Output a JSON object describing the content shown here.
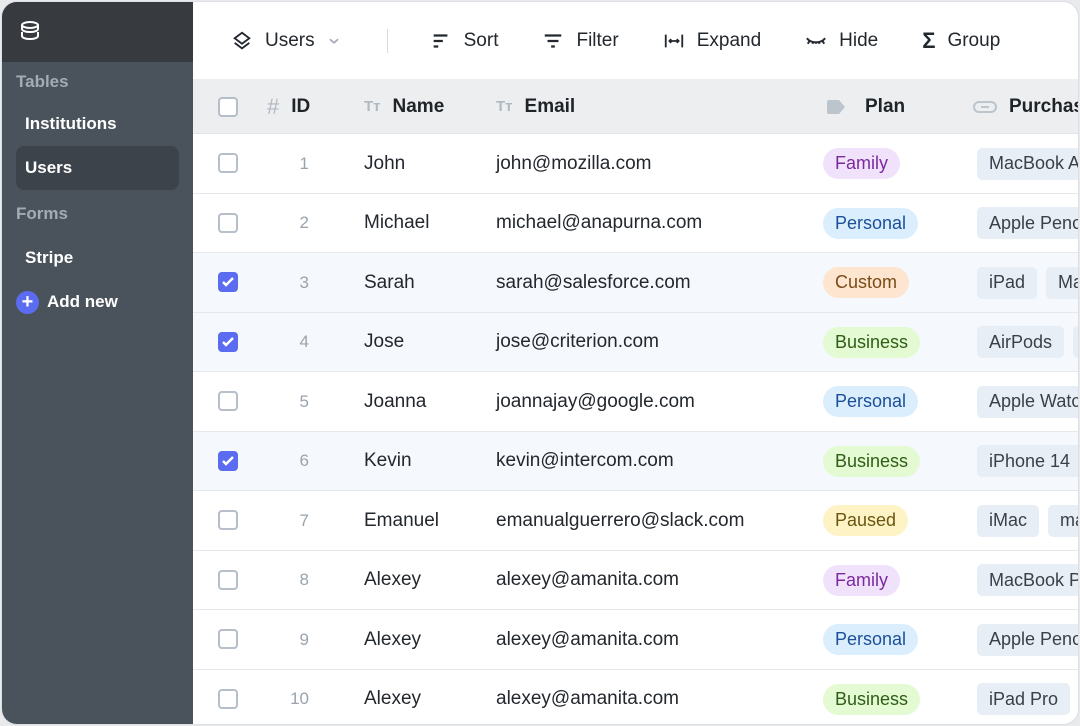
{
  "sidebar": {
    "tables_label": "Tables",
    "tables": [
      "Institutions",
      "Users"
    ],
    "active": "Users",
    "forms_label": "Forms",
    "forms": [
      "Stripe"
    ],
    "add_new": "Add new"
  },
  "toolbar": {
    "view": "Users",
    "sort": "Sort",
    "filter": "Filter",
    "expand": "Expand",
    "hide": "Hide",
    "group": "Group"
  },
  "columns": {
    "id": "ID",
    "name": "Name",
    "email": "Email",
    "plan": "Plan",
    "purchases": "Purchas"
  },
  "plan_colors": {
    "Family": {
      "bg": "#f1e2fb",
      "fg": "#7a2a9e"
    },
    "Personal": {
      "bg": "#dbeefd",
      "fg": "#1b4f99"
    },
    "Custom": {
      "bg": "#fde5cf",
      "fg": "#7a4a17"
    },
    "Business": {
      "bg": "#e3fad3",
      "fg": "#2f5d15"
    },
    "Paused": {
      "bg": "#fdf3c4",
      "fg": "#6b5512"
    }
  },
  "accent": "#5b6cf0",
  "rows": [
    {
      "id": "1",
      "name": "John",
      "email": "john@mozilla.com",
      "plan": "Family",
      "checked": false,
      "purchases": [
        "MacBook A"
      ]
    },
    {
      "id": "2",
      "name": "Michael",
      "email": "michael@anapurna.com",
      "plan": "Personal",
      "checked": false,
      "purchases": [
        "Apple Penc"
      ]
    },
    {
      "id": "3",
      "name": "Sarah",
      "email": "sarah@salesforce.com",
      "plan": "Custom",
      "checked": true,
      "purchases": [
        "iPad",
        "Ma"
      ]
    },
    {
      "id": "4",
      "name": "Jose",
      "email": "jose@criterion.com",
      "plan": "Business",
      "checked": true,
      "purchases": [
        "AirPods",
        ""
      ]
    },
    {
      "id": "5",
      "name": "Joanna",
      "email": "joannajay@google.com",
      "plan": "Personal",
      "checked": false,
      "purchases": [
        "Apple Watc"
      ]
    },
    {
      "id": "6",
      "name": "Kevin",
      "email": "kevin@intercom.com",
      "plan": "Business",
      "checked": true,
      "purchases": [
        "iPhone 14"
      ]
    },
    {
      "id": "7",
      "name": "Emanuel",
      "email": "emanualguerrero@slack.com",
      "plan": "Paused",
      "checked": false,
      "purchases": [
        "iMac",
        "ma"
      ]
    },
    {
      "id": "8",
      "name": "Alexey",
      "email": "alexey@amanita.com",
      "plan": "Family",
      "checked": false,
      "purchases": [
        "MacBook P"
      ]
    },
    {
      "id": "9",
      "name": "Alexey",
      "email": "alexey@amanita.com",
      "plan": "Personal",
      "checked": false,
      "purchases": [
        "Apple Penc"
      ]
    },
    {
      "id": "10",
      "name": "Alexey",
      "email": "alexey@amanita.com",
      "plan": "Business",
      "checked": false,
      "purchases": [
        "iPad Pro"
      ]
    }
  ]
}
